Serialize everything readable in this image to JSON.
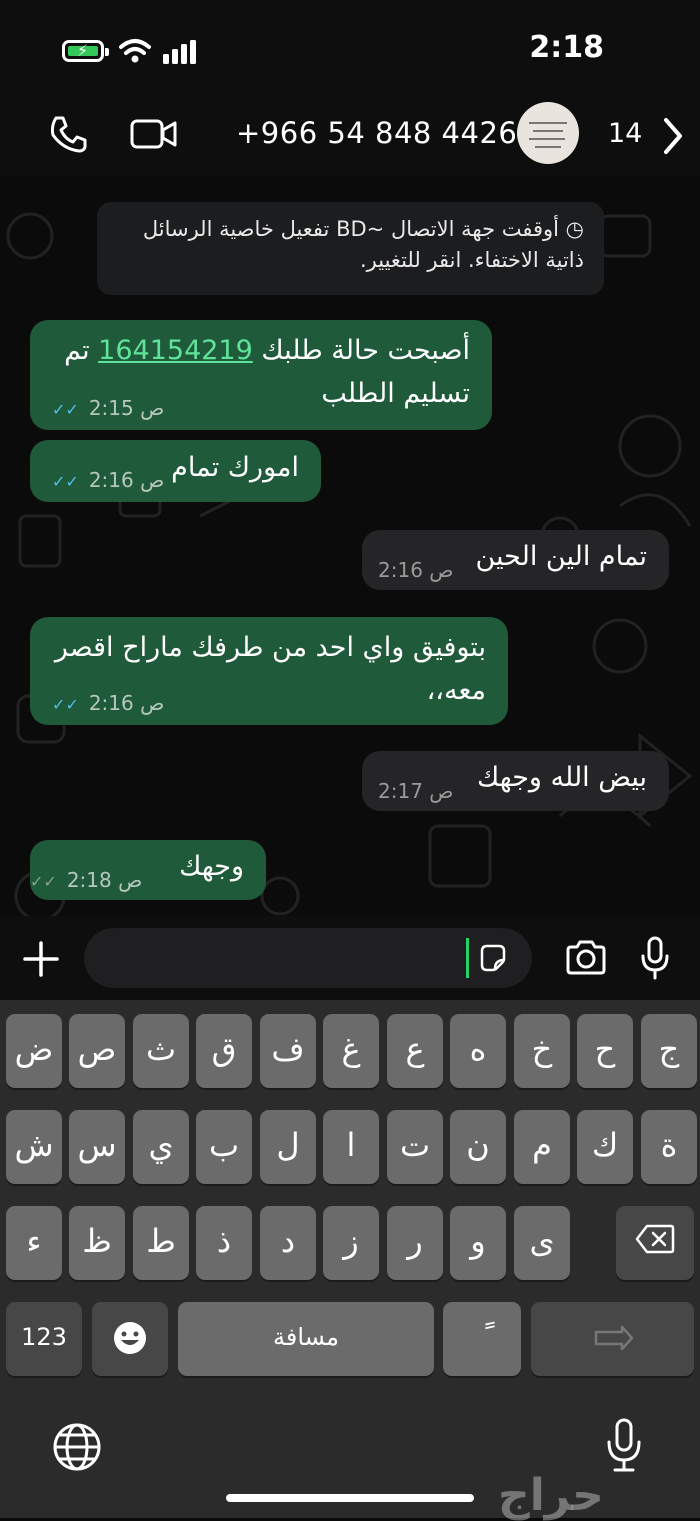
{
  "status_bar": {
    "time": "2:18"
  },
  "header": {
    "back_count": "14",
    "contact_number": "+966 54 848 4426",
    "icons": [
      "phone-icon",
      "video-call-icon",
      "back-chevron-icon",
      "avatar"
    ]
  },
  "system_message": {
    "text": "أوقفت جهة الاتصال ~BD تفعيل خاصية الرسائل ذاتية الاختفاء. انقر للتغيير."
  },
  "messages": [
    {
      "direction": "out",
      "text_before_link": "أصبحت حالة طلبك ",
      "link": "164154219",
      "text_after_link": " تم",
      "line2": "تسليم الطلب",
      "time": "2:15 ص",
      "status": "read"
    },
    {
      "direction": "out",
      "text": "امورك تمام",
      "time": "2:16 ص",
      "status": "read"
    },
    {
      "direction": "in",
      "text": "تمام الين الحين",
      "time": "2:16 ص"
    },
    {
      "direction": "out",
      "line1": "بتوفيق واي احد من طرفك ماراح اقصر",
      "line2": "معه،،",
      "time": "2:16 ص",
      "status": "read"
    },
    {
      "direction": "in",
      "text": "بيض الله وجهك",
      "time": "2:17 ص"
    },
    {
      "direction": "out",
      "text": "وجهك",
      "time": "2:18 ص",
      "status": "delivered"
    }
  ],
  "input_bar": {
    "value": "",
    "icons": [
      "plus-icon",
      "sticker-icon",
      "camera-icon",
      "microphone-icon"
    ]
  },
  "keyboard": {
    "row1": [
      "ض",
      "ص",
      "ث",
      "ق",
      "ف",
      "غ",
      "ع",
      "ه",
      "خ",
      "ح",
      "ج"
    ],
    "row2": [
      "ش",
      "س",
      "ي",
      "ب",
      "ل",
      "ا",
      "ت",
      "ن",
      "م",
      "ك",
      "ة"
    ],
    "row3": [
      "ء",
      "ظ",
      "ط",
      "ذ",
      "د",
      "ز",
      "ر",
      "و",
      "ى"
    ],
    "numbers_label": "123",
    "space_label": "مسافة",
    "tanween_label": "ً",
    "icons": [
      "emoji-icon",
      "delete-icon",
      "return-icon",
      "globe-icon",
      "dictation-icon"
    ]
  },
  "watermark": "حراج"
}
